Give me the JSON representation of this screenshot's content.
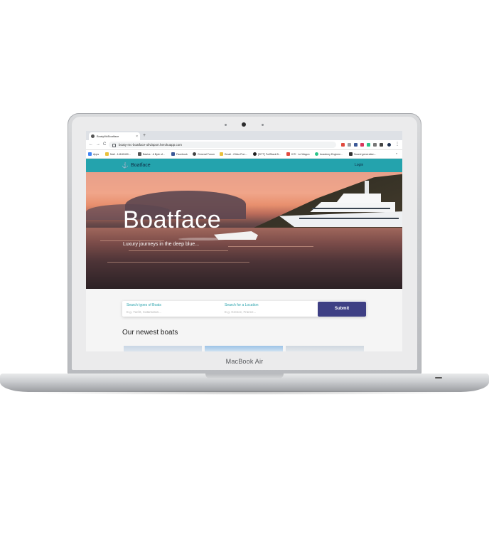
{
  "device": {
    "model_label": "MacBook Air"
  },
  "browser": {
    "tab_title": "BoatyMcBoatface",
    "tab_close": "×",
    "new_tab": "+",
    "back": "←",
    "forward": "→",
    "reload": "C",
    "url": "boaty-mc-boatface-olivlaporr.herokuapp.com",
    "bookmarks": [
      {
        "label": "Apps",
        "color": "#4285f4"
      },
      {
        "label": "Mail - 14180490...",
        "color": "#e9c13c"
      },
      {
        "label": "Basics · A Byte of...",
        "color": "#555555"
      },
      {
        "label": "Facebook",
        "color": "#3b5998"
      },
      {
        "label": "General Forum",
        "color": "#444444"
      },
      {
        "label": "Email - Olivia Porr...",
        "color": "#e9c13c"
      },
      {
        "label": "[EITT] FullStack B...",
        "color": "#222222"
      },
      {
        "label": "KiTi · Le Wagon",
        "color": "#e04a3f"
      },
      {
        "label": "Academy Enginee...",
        "color": "#2bc48a"
      },
      {
        "label": "Sound generation...",
        "color": "#333333"
      }
    ]
  },
  "site": {
    "brand": "Boatface",
    "login": "Login",
    "hero_title": "Boatface",
    "hero_subtitle": "Luxury journeys in the deep blue...",
    "search": {
      "type_label": "Search types of Boats",
      "type_placeholder": "E.g. Yacht, Catamaran...",
      "location_label": "Search for a Location",
      "location_placeholder": "E.g. Greece, France...",
      "submit": "Submit"
    },
    "newest_heading": "Our newest boats"
  },
  "colors": {
    "nav": "#24a3ad",
    "accent": "#2aa3ad",
    "submit": "#3e3f84"
  }
}
